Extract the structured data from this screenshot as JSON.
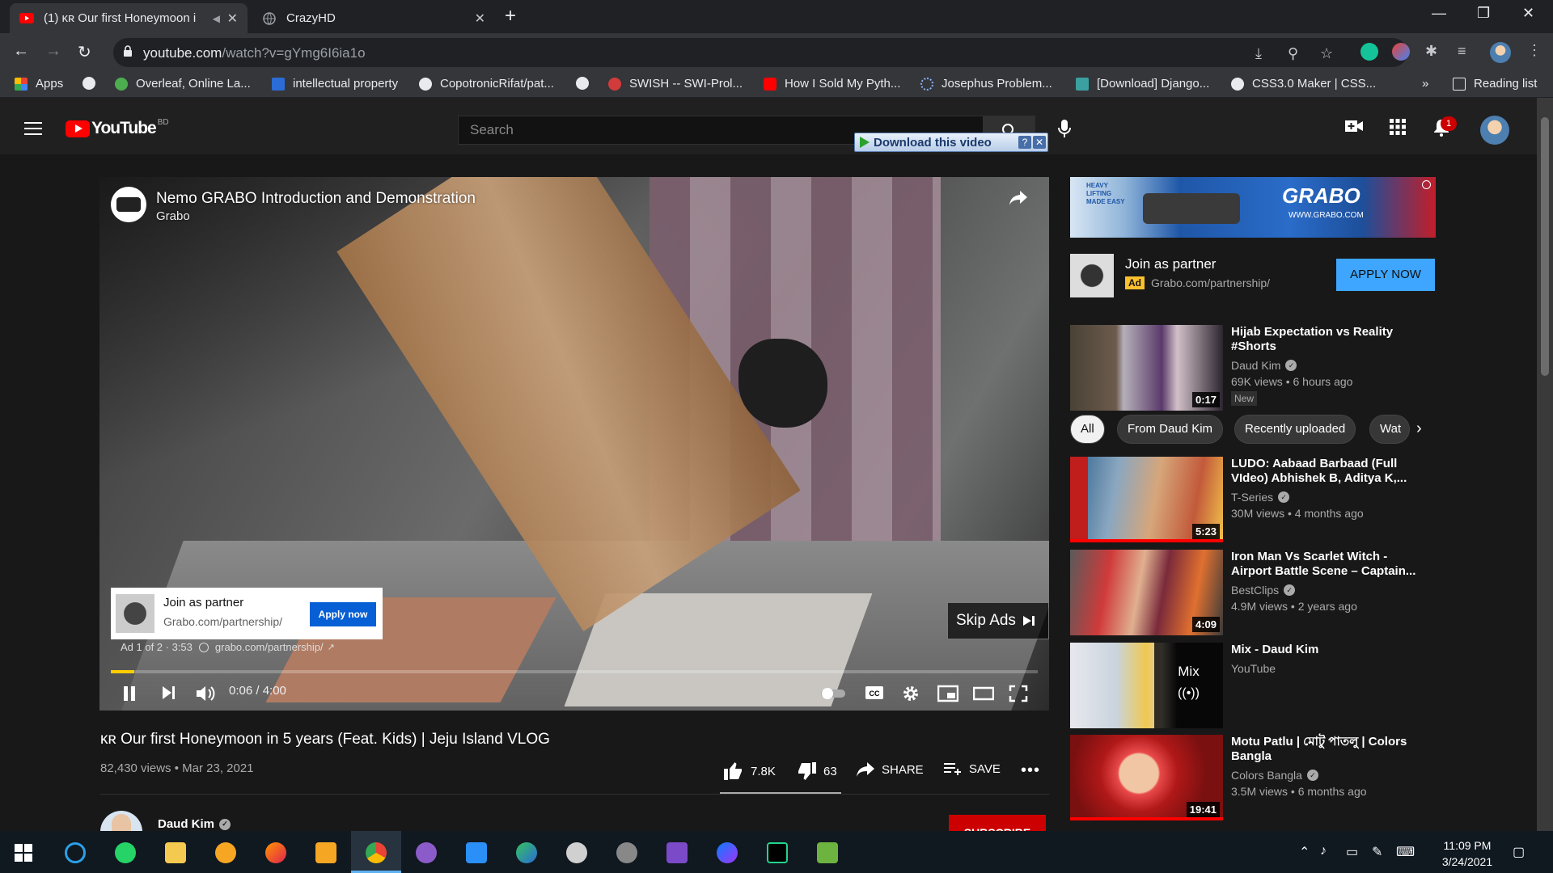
{
  "browser": {
    "tabs": [
      {
        "title": "(1) ᴋʀ Our first Honeymoon i",
        "active": true
      },
      {
        "title": "CrazyHD",
        "active": false
      }
    ],
    "url_host": "youtube.com",
    "url_path": "/watch?v=gYmg6I6ia1o",
    "bookmarks": [
      "Apps",
      "",
      "Overleaf, Online La...",
      "intellectual property",
      "CopotronicRifat/pat...",
      "",
      "SWISH -- SWI-Prol...",
      "How I Sold My Pyth...",
      "Josephus Problem...",
      "[Download] Django...",
      "CSS3.0 Maker | CSS..."
    ],
    "bookmarks_more": "»",
    "reading_list": "Reading list"
  },
  "youtube": {
    "logo_text": "YouTube",
    "country": "BD",
    "search_placeholder": "Search",
    "download_widget": "Download this video",
    "notifications_count": "1"
  },
  "player": {
    "video_title": "Nemo GRABO Introduction and Demonstration",
    "channel": "Grabo",
    "ad_card": {
      "title": "Join as partner",
      "url": "Grabo.com/partnership/",
      "button": "Apply now"
    },
    "ad_info": "Ad 1 of 2 · 3:53",
    "ad_link": "grabo.com/partnership/",
    "skip_label": "Skip Ads",
    "time": "0:06 / 4:00",
    "progress": 0.025
  },
  "video": {
    "title": "ᴋʀ Our first Honeymoon in 5 years (Feat. Kids) | Jeju Island VLOG",
    "meta": "82,430 views • Mar 23, 2021",
    "likes": "7.8K",
    "dislikes": "63",
    "share": "SHARE",
    "save": "SAVE",
    "owner": "Daud Kim",
    "subscribe": "SUBSCRIBE"
  },
  "sidebar": {
    "ad_banner": {
      "brand": "GRABO",
      "site": "WWW.GRABO.COM",
      "tagline": "HEAVY LIFTING MADE EASY"
    },
    "partner": {
      "title": "Join as partner",
      "ad_tag": "Ad",
      "url": "Grabo.com/partnership/",
      "button": "APPLY NOW"
    },
    "chips": [
      "All",
      "From Daud Kim",
      "Recently uploaded",
      "Wat"
    ],
    "recommendations": [
      {
        "title": "Hijab Expectation vs Reality #Shorts",
        "channel": "Daud Kim",
        "meta": "69K views • 6 hours ago",
        "badge": "New",
        "duration": "0:17"
      },
      {
        "title": "LUDO: Aabaad Barbaad (Full VIdeo) Abhishek B, Aditya K,...",
        "channel": "T-Series",
        "meta": "30M views • 4 months ago",
        "duration": "5:23"
      },
      {
        "title": "Iron Man Vs Scarlet Witch - Airport Battle Scene – Captain...",
        "channel": "BestClips",
        "meta": "4.9M views • 2 years ago",
        "duration": "4:09"
      },
      {
        "title": "Mix - Daud Kim",
        "channel": "YouTube",
        "meta": "",
        "mix_label": "Mix"
      },
      {
        "title": "Motu Patlu | মোটু পাতলু | Colors Bangla",
        "channel": "Colors Bangla",
        "meta": "3.5M views • 6 months ago",
        "duration": "19:41"
      }
    ]
  },
  "taskbar": {
    "time": "11:09 PM",
    "date": "3/24/2021"
  }
}
